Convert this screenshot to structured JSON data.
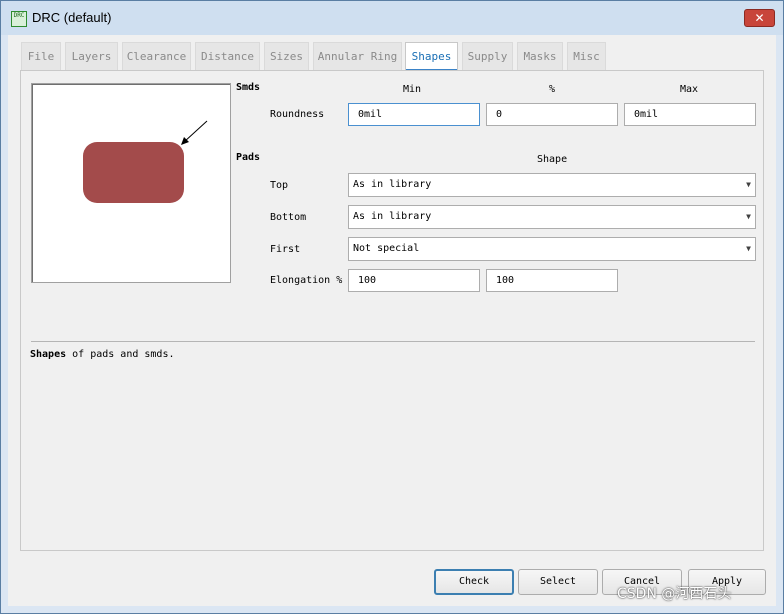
{
  "window": {
    "title": "DRC (default)",
    "icon": "drc-icon",
    "close_glyph": "✕"
  },
  "tabs": [
    {
      "label": "File"
    },
    {
      "label": "Layers"
    },
    {
      "label": "Clearance"
    },
    {
      "label": "Distance"
    },
    {
      "label": "Sizes"
    },
    {
      "label": "Annular Ring"
    },
    {
      "label": "Shapes",
      "active": true
    },
    {
      "label": "Supply"
    },
    {
      "label": "Masks"
    },
    {
      "label": "Misc"
    }
  ],
  "preview": {
    "shape_color": "#a34b4b",
    "icon": "pad-shape-preview"
  },
  "smds": {
    "section_label": "Smds",
    "col_min": "Min",
    "col_percent": "%",
    "col_max": "Max",
    "roundness_label": "Roundness",
    "roundness_min": "0mil",
    "roundness_percent": "0",
    "roundness_max": "0mil"
  },
  "pads": {
    "section_label": "Pads",
    "shape_header": "Shape",
    "top_label": "Top",
    "top_value": "As in library",
    "bottom_label": "Bottom",
    "bottom_value": "As in library",
    "first_label": "First",
    "first_value": "Not special",
    "elongation_label": "Elongation %",
    "elongation_1": "100",
    "elongation_2": "100"
  },
  "description": {
    "bold": "Shapes",
    "text": " of pads and smds."
  },
  "buttons": {
    "check": "Check",
    "select": "Select",
    "cancel": "Cancel",
    "apply": "Apply"
  },
  "watermark": "CSDN @河西石头",
  "colors": {
    "accent": "#3a83c8",
    "titlebar": "#cfdff0",
    "pad": "#a34b4b"
  }
}
